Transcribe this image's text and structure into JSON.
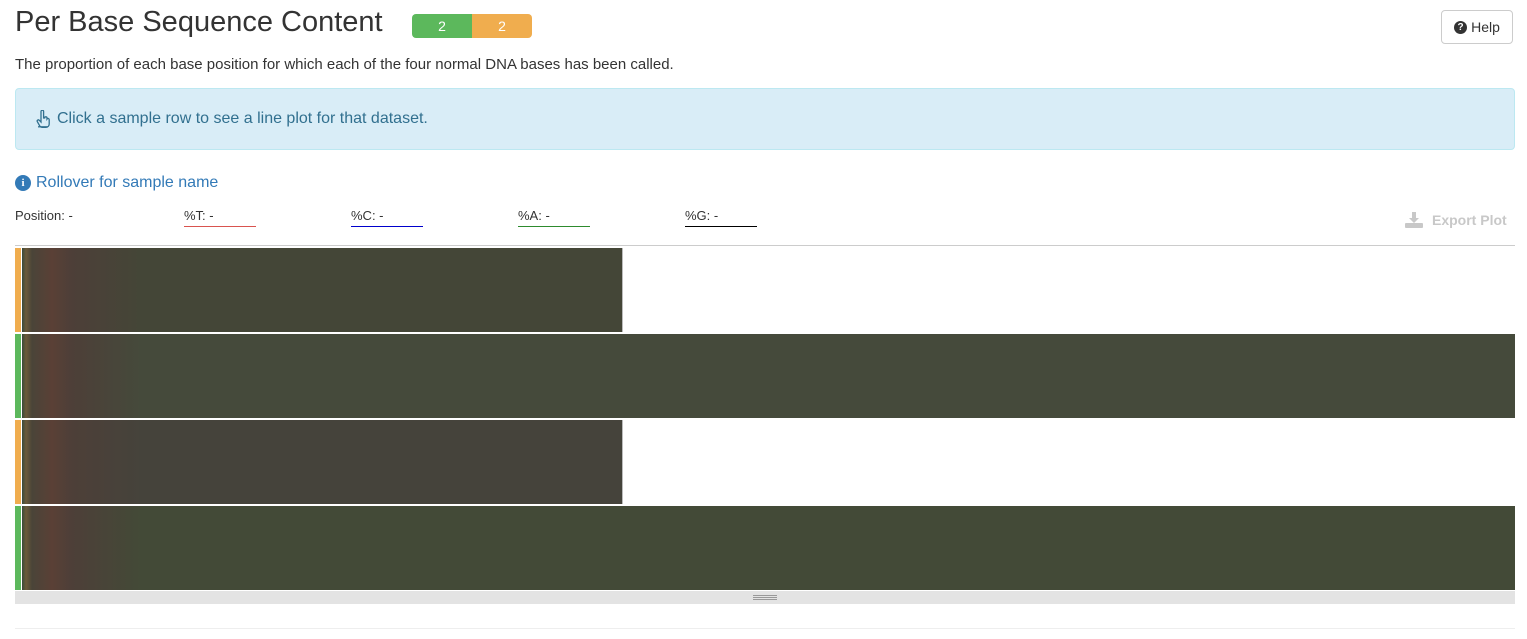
{
  "header": {
    "title": "Per Base Sequence Content",
    "badges": [
      {
        "label": "2",
        "status": "pass",
        "color": "#5cb85c"
      },
      {
        "label": "2",
        "status": "warn",
        "color": "#f0ad4e"
      }
    ],
    "help_label": "Help"
  },
  "description": "The proportion of each base position for which each of the four normal DNA bases has been called.",
  "alert": {
    "icon": "hand-pointer-icon",
    "text": "Click a sample row to see a line plot for that dataset."
  },
  "rollover": {
    "icon": "info-icon",
    "text": "Rollover for sample name"
  },
  "readouts": {
    "position": "Position: -",
    "t": {
      "label": "%T: -",
      "color": "#d9534f"
    },
    "c": {
      "label": "%C: -",
      "color": "#0000cc"
    },
    "a": {
      "label": "%A: -",
      "color": "#2e8b2e"
    },
    "g": {
      "label": "%G: -",
      "color": "#000000"
    }
  },
  "export_label": "Export Plot",
  "heatmap": {
    "rows": [
      {
        "status": "warn",
        "status_color": "#f0ad4e",
        "length_fraction": 0.402,
        "fill": "#444637"
      },
      {
        "status": "pass",
        "status_color": "#5cb85c",
        "length_fraction": 1.0,
        "fill": "#454a3b"
      },
      {
        "status": "warn",
        "status_color": "#f0ad4e",
        "length_fraction": 0.402,
        "fill": "#45433b"
      },
      {
        "status": "pass",
        "status_color": "#5cb85c",
        "length_fraction": 1.0,
        "fill": "#434a37"
      }
    ]
  }
}
